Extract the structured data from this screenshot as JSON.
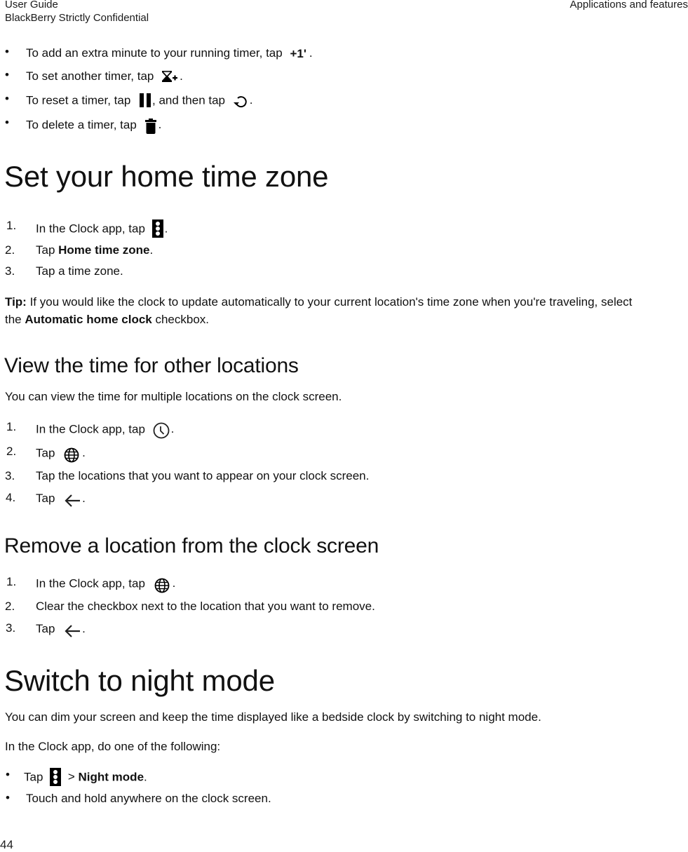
{
  "header": {
    "doc_title": "User Guide",
    "confidentiality": "BlackBerry Strictly Confidential",
    "section": "Applications and features"
  },
  "timer_bullets": [
    {
      "before": "To add an extra minute to your running timer, tap",
      "icon": "plus-one-minute-icon",
      "after": "."
    },
    {
      "before": "To set another timer, tap",
      "icon": "add-timer-icon",
      "after": "."
    },
    {
      "before": "To reset a timer, tap",
      "icon": "pause-icon",
      "middle": ", and then tap",
      "icon2": "reset-icon",
      "after": "."
    },
    {
      "before": "To delete a timer, tap",
      "icon": "trash-icon",
      "after": "."
    }
  ],
  "home_tz": {
    "heading": "Set your home time zone",
    "steps": [
      {
        "num": "1.",
        "before": "In the Clock app, tap",
        "icon": "more-options-icon",
        "after": "."
      },
      {
        "num": "2.",
        "before": "Tap ",
        "bold": "Home time zone",
        "after": "."
      },
      {
        "num": "3.",
        "text": "Tap a time zone."
      }
    ],
    "tip": {
      "label": "Tip:",
      "line1": " If you would like the clock to update automatically to your current location's time zone when you're traveling, select",
      "line2_before": "the ",
      "line2_bold": "Automatic home clock",
      "line2_after": " checkbox."
    }
  },
  "other_locations": {
    "heading": "View the time for other locations",
    "intro": "You can view the time for multiple locations on the clock screen.",
    "steps": [
      {
        "num": "1.",
        "before": "In the Clock app, tap",
        "icon": "clock-icon",
        "after": "."
      },
      {
        "num": "2.",
        "before": "Tap",
        "icon": "globe-icon",
        "after": "."
      },
      {
        "num": "3.",
        "text": "Tap the locations that you want to appear on your clock screen."
      },
      {
        "num": "4.",
        "before": "Tap",
        "icon": "back-arrow-icon",
        "after": "."
      }
    ]
  },
  "remove_location": {
    "heading": "Remove a location from the clock screen",
    "steps": [
      {
        "num": "1.",
        "before": "In the Clock app, tap",
        "icon": "globe-icon",
        "after": "."
      },
      {
        "num": "2.",
        "text": "Clear the checkbox next to the location that you want to remove."
      },
      {
        "num": "3.",
        "before": "Tap",
        "icon": "back-arrow-icon",
        "after": "."
      }
    ]
  },
  "night_mode": {
    "heading": "Switch to night mode",
    "intro": "You can dim your screen and keep the time displayed like a bedside clock by switching to night mode.",
    "lead": "In the Clock app, do one of the following:",
    "bullets": [
      {
        "before": "Tap",
        "icon": "more-options-icon",
        "middle": " > ",
        "bold": "Night mode",
        "after": "."
      },
      {
        "text": "Touch and hold anywhere on the clock screen."
      }
    ]
  },
  "footer": {
    "page_number": "44"
  },
  "bullet_char": "•"
}
